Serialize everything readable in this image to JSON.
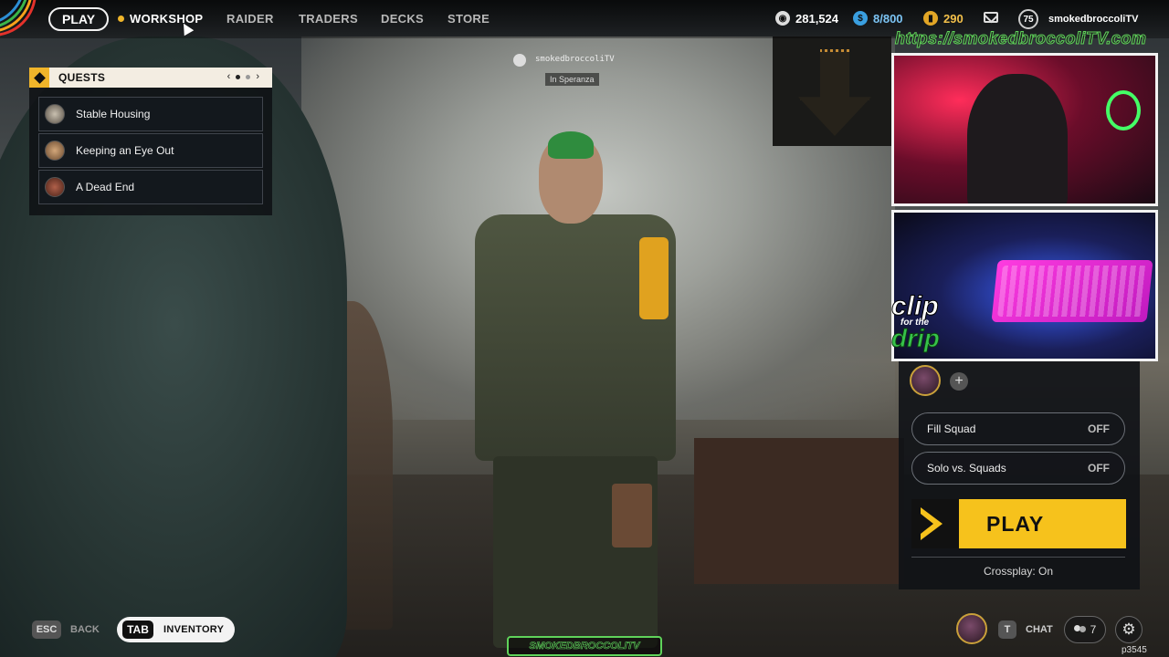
{
  "nav": {
    "play": "PLAY",
    "items": [
      "WORKSHOP",
      "RAIDER",
      "TRADERS",
      "DECKS",
      "STORE"
    ],
    "active": "WORKSHOP"
  },
  "currency": {
    "coins": "281,524",
    "coins_icon": "coin-icon",
    "stash": "8/800",
    "stash_icon": "stash-icon",
    "tokens": "290",
    "tokens_icon": "token-icon"
  },
  "profile": {
    "level": "75",
    "username": "smokedbroccoliTV"
  },
  "quests": {
    "title": "QUESTS",
    "prev": "‹",
    "next": "›",
    "items": [
      {
        "label": "Stable Housing"
      },
      {
        "label": "Keeping an Eye Out"
      },
      {
        "label": "A Dead End"
      }
    ]
  },
  "character": {
    "name": "smokedbroccoliTV",
    "location": "In Speranza"
  },
  "overlay": {
    "site": "https://smokedbroccoliTV.com",
    "clip_1": "clip",
    "clip_2": "for the",
    "clip_3": "drip",
    "bottom_name": "SMOKEDBROCCOLITV"
  },
  "party": {
    "add": "+"
  },
  "options": {
    "fill_squad": {
      "label": "Fill Squad",
      "value": "OFF"
    },
    "solo_vs_squads": {
      "label": "Solo vs. Squads",
      "value": "OFF"
    }
  },
  "play_button": {
    "label": "PLAY"
  },
  "crossplay": "Crossplay: On",
  "bottom": {
    "esc_key": "ESC",
    "back": "BACK",
    "tab_key": "TAB",
    "inventory": "INVENTORY",
    "t_key": "T",
    "chat": "CHAT",
    "friends_count": "7",
    "settings_glyph": "⚙",
    "build": "p3545"
  },
  "colors": {
    "accent_yellow": "#f6c21c",
    "overlay_green": "#5fd35a",
    "quest_header": "#f3ede2"
  }
}
